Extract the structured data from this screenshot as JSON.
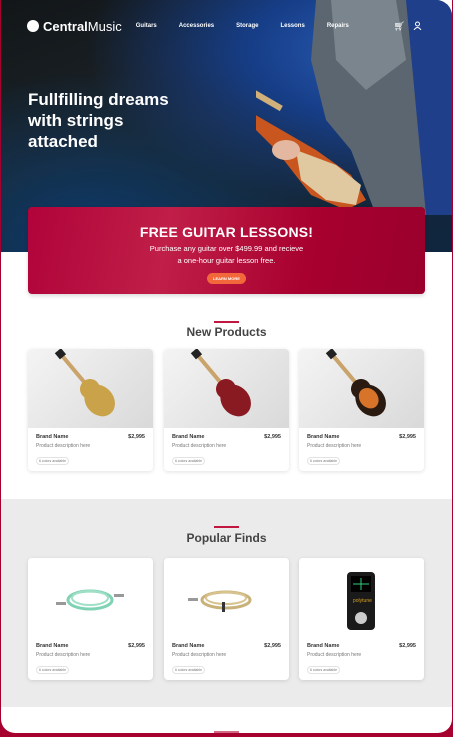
{
  "nav": {
    "brand_bold": "Central",
    "brand_light": "Music",
    "links": [
      "Guitars",
      "Accessories",
      "Storage",
      "Lessons",
      "Repairs"
    ],
    "icons": [
      "cart-icon",
      "user-icon"
    ]
  },
  "hero": {
    "headline": "Fullfilling dreams with strings attached"
  },
  "promo": {
    "title": "FREE GUITAR LESSONS!",
    "line1": "Purchase any guitar over $499.99 and recieve",
    "line2": "a one-hour guitar lesson free.",
    "button": "LEARN MORE"
  },
  "new_products": {
    "title": "New Products",
    "items": [
      {
        "brand": "Brand Name",
        "price": "$2,995",
        "desc": "Product description here",
        "colors": "6 colors available"
      },
      {
        "brand": "Brand Name",
        "price": "$2,995",
        "desc": "Product description here",
        "colors": "6 colors available"
      },
      {
        "brand": "Brand Name",
        "price": "$2,995",
        "desc": "Product description here",
        "colors": "6 colors available"
      }
    ]
  },
  "popular": {
    "title": "Popular Finds",
    "items": [
      {
        "brand": "Brand Name",
        "price": "$2,995",
        "desc": "Product description here",
        "colors": "6 colors available"
      },
      {
        "brand": "Brand Name",
        "price": "$2,995",
        "desc": "Product description here",
        "colors": "6 colors available"
      },
      {
        "brand": "Brand Name",
        "price": "$2,995",
        "desc": "Product description here",
        "colors": "6 colors available"
      }
    ]
  },
  "colors": {
    "accent": "#a6002f",
    "button": "#f2683a"
  }
}
